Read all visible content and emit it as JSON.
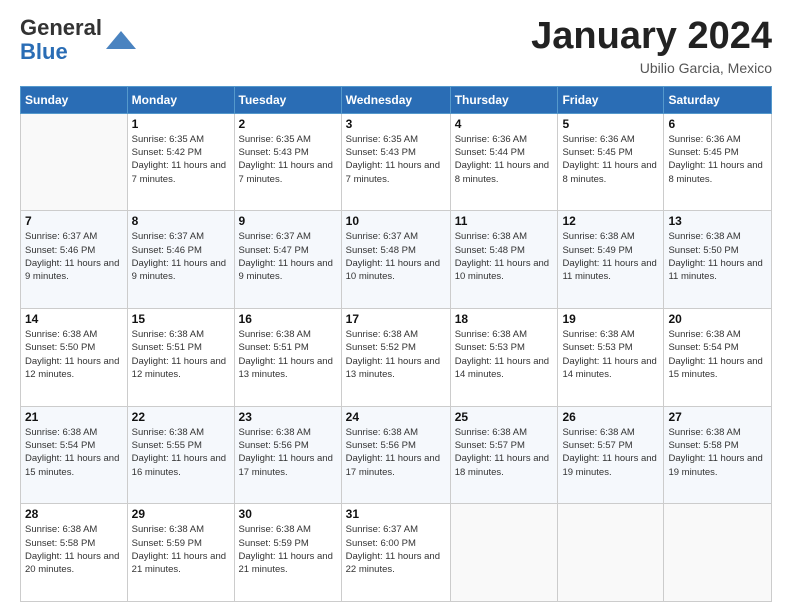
{
  "header": {
    "logo_general": "General",
    "logo_blue": "Blue",
    "month_title": "January 2024",
    "location": "Ubilio Garcia, Mexico"
  },
  "days_of_week": [
    "Sunday",
    "Monday",
    "Tuesday",
    "Wednesday",
    "Thursday",
    "Friday",
    "Saturday"
  ],
  "weeks": [
    [
      {
        "day": "",
        "sunrise": "",
        "sunset": "",
        "daylight": ""
      },
      {
        "day": "1",
        "sunrise": "6:35 AM",
        "sunset": "5:42 PM",
        "daylight": "11 hours and 7 minutes."
      },
      {
        "day": "2",
        "sunrise": "6:35 AM",
        "sunset": "5:43 PM",
        "daylight": "11 hours and 7 minutes."
      },
      {
        "day": "3",
        "sunrise": "6:35 AM",
        "sunset": "5:43 PM",
        "daylight": "11 hours and 7 minutes."
      },
      {
        "day": "4",
        "sunrise": "6:36 AM",
        "sunset": "5:44 PM",
        "daylight": "11 hours and 8 minutes."
      },
      {
        "day": "5",
        "sunrise": "6:36 AM",
        "sunset": "5:45 PM",
        "daylight": "11 hours and 8 minutes."
      },
      {
        "day": "6",
        "sunrise": "6:36 AM",
        "sunset": "5:45 PM",
        "daylight": "11 hours and 8 minutes."
      }
    ],
    [
      {
        "day": "7",
        "sunrise": "6:37 AM",
        "sunset": "5:46 PM",
        "daylight": "11 hours and 9 minutes."
      },
      {
        "day": "8",
        "sunrise": "6:37 AM",
        "sunset": "5:46 PM",
        "daylight": "11 hours and 9 minutes."
      },
      {
        "day": "9",
        "sunrise": "6:37 AM",
        "sunset": "5:47 PM",
        "daylight": "11 hours and 9 minutes."
      },
      {
        "day": "10",
        "sunrise": "6:37 AM",
        "sunset": "5:48 PM",
        "daylight": "11 hours and 10 minutes."
      },
      {
        "day": "11",
        "sunrise": "6:38 AM",
        "sunset": "5:48 PM",
        "daylight": "11 hours and 10 minutes."
      },
      {
        "day": "12",
        "sunrise": "6:38 AM",
        "sunset": "5:49 PM",
        "daylight": "11 hours and 11 minutes."
      },
      {
        "day": "13",
        "sunrise": "6:38 AM",
        "sunset": "5:50 PM",
        "daylight": "11 hours and 11 minutes."
      }
    ],
    [
      {
        "day": "14",
        "sunrise": "6:38 AM",
        "sunset": "5:50 PM",
        "daylight": "11 hours and 12 minutes."
      },
      {
        "day": "15",
        "sunrise": "6:38 AM",
        "sunset": "5:51 PM",
        "daylight": "11 hours and 12 minutes."
      },
      {
        "day": "16",
        "sunrise": "6:38 AM",
        "sunset": "5:51 PM",
        "daylight": "11 hours and 13 minutes."
      },
      {
        "day": "17",
        "sunrise": "6:38 AM",
        "sunset": "5:52 PM",
        "daylight": "11 hours and 13 minutes."
      },
      {
        "day": "18",
        "sunrise": "6:38 AM",
        "sunset": "5:53 PM",
        "daylight": "11 hours and 14 minutes."
      },
      {
        "day": "19",
        "sunrise": "6:38 AM",
        "sunset": "5:53 PM",
        "daylight": "11 hours and 14 minutes."
      },
      {
        "day": "20",
        "sunrise": "6:38 AM",
        "sunset": "5:54 PM",
        "daylight": "11 hours and 15 minutes."
      }
    ],
    [
      {
        "day": "21",
        "sunrise": "6:38 AM",
        "sunset": "5:54 PM",
        "daylight": "11 hours and 15 minutes."
      },
      {
        "day": "22",
        "sunrise": "6:38 AM",
        "sunset": "5:55 PM",
        "daylight": "11 hours and 16 minutes."
      },
      {
        "day": "23",
        "sunrise": "6:38 AM",
        "sunset": "5:56 PM",
        "daylight": "11 hours and 17 minutes."
      },
      {
        "day": "24",
        "sunrise": "6:38 AM",
        "sunset": "5:56 PM",
        "daylight": "11 hours and 17 minutes."
      },
      {
        "day": "25",
        "sunrise": "6:38 AM",
        "sunset": "5:57 PM",
        "daylight": "11 hours and 18 minutes."
      },
      {
        "day": "26",
        "sunrise": "6:38 AM",
        "sunset": "5:57 PM",
        "daylight": "11 hours and 19 minutes."
      },
      {
        "day": "27",
        "sunrise": "6:38 AM",
        "sunset": "5:58 PM",
        "daylight": "11 hours and 19 minutes."
      }
    ],
    [
      {
        "day": "28",
        "sunrise": "6:38 AM",
        "sunset": "5:58 PM",
        "daylight": "11 hours and 20 minutes."
      },
      {
        "day": "29",
        "sunrise": "6:38 AM",
        "sunset": "5:59 PM",
        "daylight": "11 hours and 21 minutes."
      },
      {
        "day": "30",
        "sunrise": "6:38 AM",
        "sunset": "5:59 PM",
        "daylight": "11 hours and 21 minutes."
      },
      {
        "day": "31",
        "sunrise": "6:37 AM",
        "sunset": "6:00 PM",
        "daylight": "11 hours and 22 minutes."
      },
      {
        "day": "",
        "sunrise": "",
        "sunset": "",
        "daylight": ""
      },
      {
        "day": "",
        "sunrise": "",
        "sunset": "",
        "daylight": ""
      },
      {
        "day": "",
        "sunrise": "",
        "sunset": "",
        "daylight": ""
      }
    ]
  ],
  "labels": {
    "sunrise": "Sunrise:",
    "sunset": "Sunset:",
    "daylight": "Daylight:"
  }
}
